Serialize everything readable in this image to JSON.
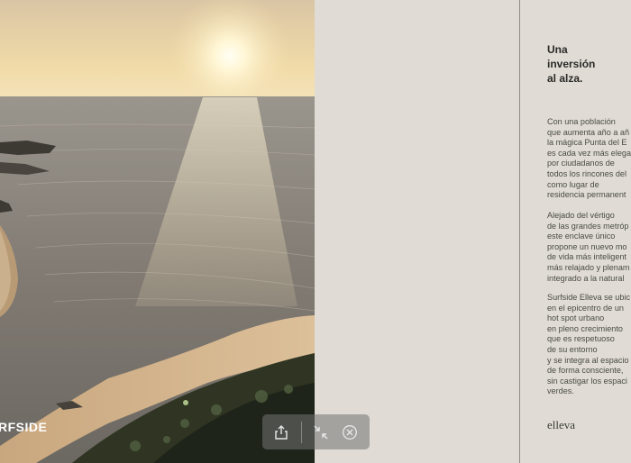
{
  "photo": {
    "brand_text": "RFSIDE",
    "sky_color": "#efd9a6",
    "sea_color": "#7c7872",
    "sun_color": "#fffbe6"
  },
  "article": {
    "headline": "Una\ninversión\nal alza.",
    "paragraph_1": "Con una población\nque aumenta año a añ\nla mágica Punta del E\nes cada vez más elega\npor ciudadanos de\ntodos los rincones del\ncomo lugar de\nresidencia permanent",
    "paragraph_2": "Alejado del vértigo\nde las grandes metróp\neste enclave único\npropone un nuevo mo\nde vida más inteligent\nmás relajado y plenam\nintegrado a la natural",
    "paragraph_3": "Surfside Elleva se ubic\nen el epicentro de un\nhot spot urbano\nen pleno crecimiento\nque es respetuoso\nde su entorno\ny se integra al espacio\nde forma consciente,\nsin castigar los espaci\nverdes.",
    "logo": "elleva"
  },
  "toolbar": {
    "share_icon": "share-icon",
    "collapse_icon": "collapse-arrows-icon",
    "close_icon": "close-circle-icon"
  }
}
